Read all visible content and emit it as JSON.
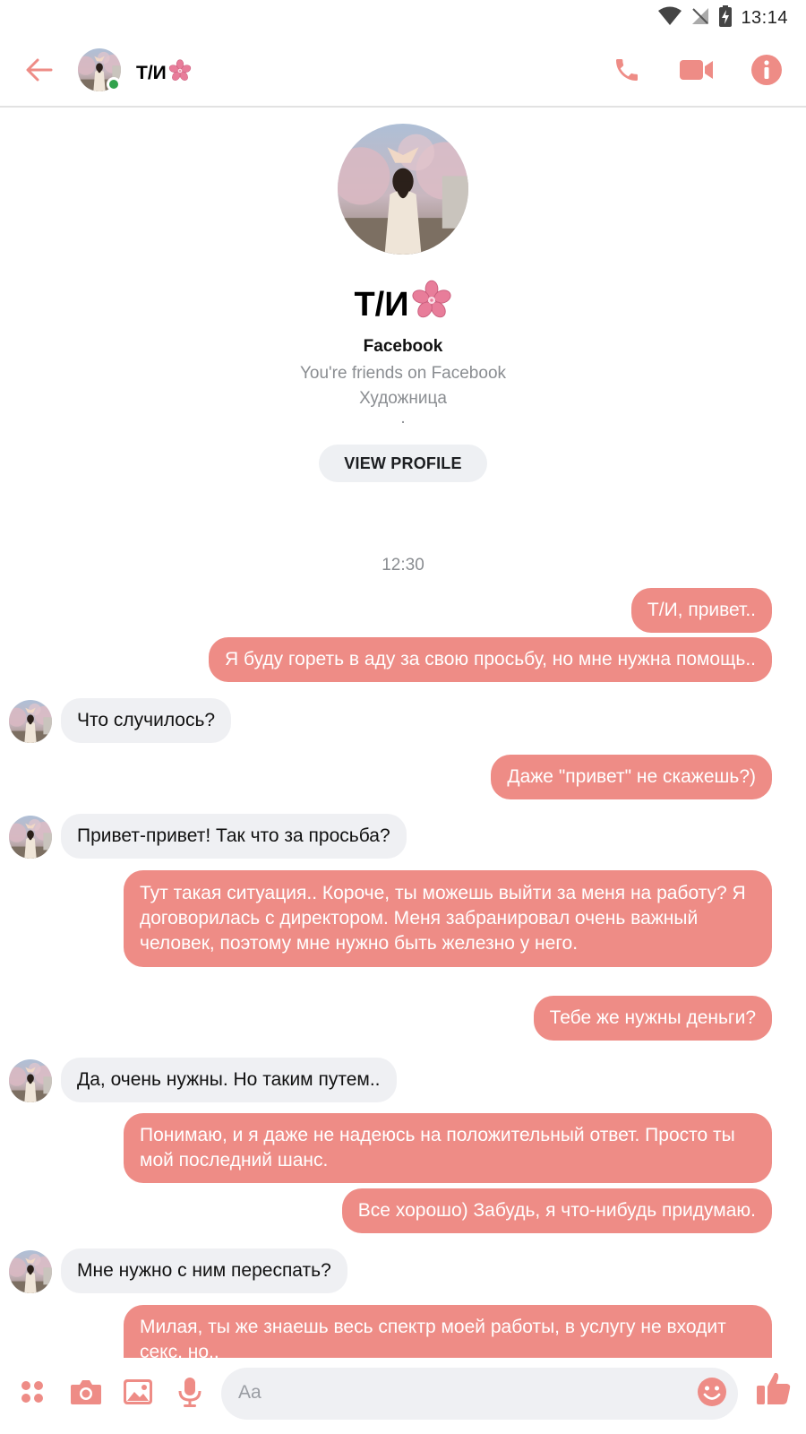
{
  "status_bar": {
    "time": "13:14",
    "icons": [
      "wifi-icon",
      "no-signal-icon",
      "battery-charging-icon"
    ]
  },
  "header": {
    "back_icon": "arrow-left-icon",
    "contact_name": "Т/И",
    "online": true,
    "actions": [
      "phone-icon",
      "video-camera-icon",
      "info-icon"
    ]
  },
  "profile": {
    "name": "Т/И",
    "line1": "Facebook",
    "line2": "You're friends on Facebook",
    "line3": "Художница",
    "line4": ".",
    "view_profile_label": "VIEW PROFILE"
  },
  "conversation": {
    "timestamp": "12:30",
    "messages": [
      {
        "from": "me",
        "text": "Т/И, привет.."
      },
      {
        "from": "me",
        "text": "Я буду гореть в аду за свою просьбу, но мне нужна помощь.."
      },
      {
        "from": "them",
        "text": "Что случилось?"
      },
      {
        "from": "me",
        "text": "Даже \"привет\" не скажешь?)"
      },
      {
        "from": "them",
        "text": "Привет-привет! Так что за просьба?"
      },
      {
        "from": "me",
        "text": "Тут такая ситуация.. Короче, ты можешь выйти за меня на работу? Я договорилась с директором. Меня забранировал очень важный человек, поэтому мне нужно быть железно у него."
      },
      {
        "from": "me",
        "text": "Тебе же нужны деньги?"
      },
      {
        "from": "them",
        "text": "Да, очень нужны. Но таким путем.."
      },
      {
        "from": "me",
        "text": "Понимаю, и я даже не надеюсь на положительный ответ. Просто ты мой последний шанс."
      },
      {
        "from": "me",
        "text": "Все хорошо) Забудь, я что-нибудь придумаю."
      },
      {
        "from": "them",
        "text": "Мне нужно с ним переспать?"
      },
      {
        "from": "me",
        "text": "Милая, ты же знаешь весь спектр моей работы, в услугу не входит секс, но.."
      }
    ]
  },
  "composer": {
    "placeholder": "Aa",
    "icons": [
      "apps-dots-icon",
      "camera-icon",
      "gallery-icon",
      "microphone-icon",
      "emoji-icon",
      "thumbs-up-icon"
    ]
  },
  "colors": {
    "accent": "#ee8c86",
    "incoming_bubble": "#eff0f3",
    "online": "#31a24c",
    "secondary_text": "#8a8d91"
  }
}
